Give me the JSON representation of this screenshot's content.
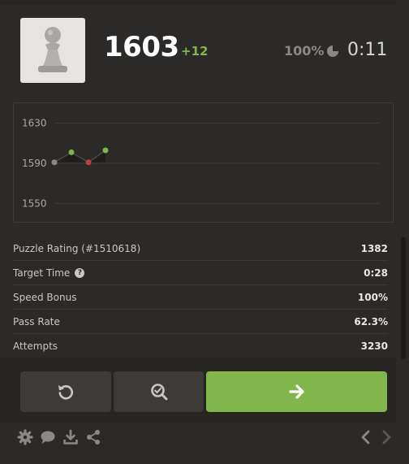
{
  "header": {
    "rating": "1603",
    "rating_change": "+12",
    "accuracy": "100%",
    "timer": "0:11"
  },
  "chart_data": {
    "type": "line",
    "title": "",
    "xlabel": "",
    "ylabel": "",
    "yticks": [
      1630,
      1590,
      1550
    ],
    "ylim": [
      1530,
      1650
    ],
    "grid": true,
    "points": [
      {
        "x": 0,
        "y": 1591,
        "status": "neutral"
      },
      {
        "x": 1,
        "y": 1601,
        "status": "solved"
      },
      {
        "x": 2,
        "y": 1591,
        "status": "failed"
      },
      {
        "x": 3,
        "y": 1603,
        "status": "solved"
      }
    ],
    "colors": {
      "neutral": "#8b8987",
      "solved": "#81b64c",
      "failed": "#c33a3a"
    }
  },
  "stats": [
    {
      "label": "Puzzle Rating (#1510618)",
      "value": "1382",
      "help": false
    },
    {
      "label": "Target Time",
      "value": "0:28",
      "help": true
    },
    {
      "label": "Speed Bonus",
      "value": "100%",
      "help": false
    },
    {
      "label": "Pass Rate",
      "value": "62.3%",
      "help": false
    },
    {
      "label": "Attempts",
      "value": "3230",
      "help": false
    }
  ],
  "icons": {
    "piece": "pawn-icon",
    "retry": "retry-icon",
    "analyze": "analysis-icon",
    "next": "arrow-right-icon",
    "footer": [
      "gear-icon",
      "chat-icon",
      "download-icon",
      "share-icon",
      "chevron-left-icon",
      "chevron-right-icon"
    ]
  }
}
